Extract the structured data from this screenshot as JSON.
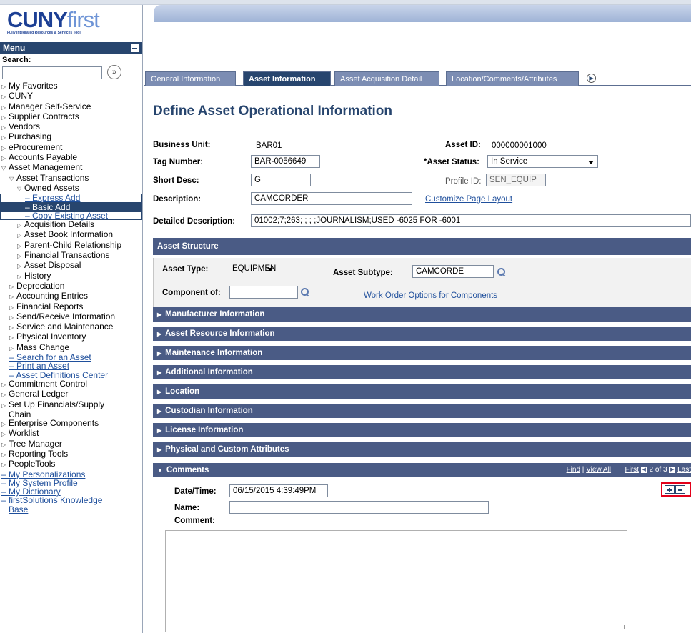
{
  "logo": {
    "cuny": "CUNY",
    "first": "first",
    "tagline": "Fully Integrated Resources & Services Tool"
  },
  "menu": {
    "title": "Menu",
    "search_label": "Search:",
    "search_value": "",
    "search_go": "»"
  },
  "nav": [
    {
      "label": "My Favorites",
      "indent": 0,
      "kind": "folder"
    },
    {
      "label": "CUNY",
      "indent": 0,
      "kind": "folder"
    },
    {
      "label": "Manager Self-Service",
      "indent": 0,
      "kind": "folder"
    },
    {
      "label": "Supplier Contracts",
      "indent": 0,
      "kind": "folder"
    },
    {
      "label": "Vendors",
      "indent": 0,
      "kind": "folder"
    },
    {
      "label": "Purchasing",
      "indent": 0,
      "kind": "folder"
    },
    {
      "label": "eProcurement",
      "indent": 0,
      "kind": "folder"
    },
    {
      "label": "Accounts Payable",
      "indent": 0,
      "kind": "folder"
    },
    {
      "label": "Asset Management",
      "indent": 0,
      "kind": "open"
    },
    {
      "label": "Asset Transactions",
      "indent": 1,
      "kind": "open"
    },
    {
      "label": "Owned Assets",
      "indent": 2,
      "kind": "open"
    },
    {
      "label": "Express Add",
      "indent": 3,
      "kind": "link"
    },
    {
      "label": "Basic Add",
      "indent": 3,
      "kind": "selected"
    },
    {
      "label": "Copy Existing Asset",
      "indent": 3,
      "kind": "link"
    },
    {
      "label": "Acquisition Details",
      "indent": 2,
      "kind": "folder"
    },
    {
      "label": "Asset Book Information",
      "indent": 2,
      "kind": "folder"
    },
    {
      "label": "Parent-Child Relationship",
      "indent": 2,
      "kind": "folder"
    },
    {
      "label": "Financial Transactions",
      "indent": 2,
      "kind": "folder"
    },
    {
      "label": "Asset Disposal",
      "indent": 2,
      "kind": "folder"
    },
    {
      "label": "History",
      "indent": 2,
      "kind": "folder"
    },
    {
      "label": "Depreciation",
      "indent": 1,
      "kind": "folder"
    },
    {
      "label": "Accounting Entries",
      "indent": 1,
      "kind": "folder"
    },
    {
      "label": "Financial Reports",
      "indent": 1,
      "kind": "folder"
    },
    {
      "label": "Send/Receive Information",
      "indent": 1,
      "kind": "folder"
    },
    {
      "label": "Service and Maintenance",
      "indent": 1,
      "kind": "folder"
    },
    {
      "label": "Physical Inventory",
      "indent": 1,
      "kind": "folder"
    },
    {
      "label": "Mass Change",
      "indent": 1,
      "kind": "folder"
    },
    {
      "label": "Search for an Asset",
      "indent": 1,
      "kind": "link"
    },
    {
      "label": "Print an Asset",
      "indent": 1,
      "kind": "link"
    },
    {
      "label": "Asset Definitions Center",
      "indent": 1,
      "kind": "link"
    },
    {
      "label": "Commitment Control",
      "indent": 0,
      "kind": "folder"
    },
    {
      "label": "General Ledger",
      "indent": 0,
      "kind": "folder"
    },
    {
      "label": "Set Up Financials/Supply",
      "indent": 0,
      "kind": "folder"
    },
    {
      "label": "Chain",
      "indent": 0,
      "kind": "cont"
    },
    {
      "label": "Enterprise Components",
      "indent": 0,
      "kind": "folder"
    },
    {
      "label": "Worklist",
      "indent": 0,
      "kind": "folder"
    },
    {
      "label": "Tree Manager",
      "indent": 0,
      "kind": "folder"
    },
    {
      "label": "Reporting Tools",
      "indent": 0,
      "kind": "folder"
    },
    {
      "label": "PeopleTools",
      "indent": 0,
      "kind": "folder"
    },
    {
      "label": "My Personalizations",
      "indent": 0,
      "kind": "link"
    },
    {
      "label": "My System Profile",
      "indent": 0,
      "kind": "link"
    },
    {
      "label": "My Dictionary",
      "indent": 0,
      "kind": "link"
    },
    {
      "label": "firstSolutions Knowledge",
      "indent": 0,
      "kind": "link"
    },
    {
      "label": "Base",
      "indent": 0,
      "kind": "cont-link"
    }
  ],
  "tabs": [
    "General Information",
    "Asset Information",
    "Asset Acquisition Detail",
    "Location/Comments/Attributes"
  ],
  "active_tab": "Asset Information",
  "page_title": "Define Asset Operational Information",
  "fields": {
    "business_unit_label": "Business Unit:",
    "business_unit": "BAR01",
    "asset_id_label": "Asset ID:",
    "asset_id": "000000001000",
    "tag_number_label": "Tag Number:",
    "tag_number": "BAR-0056649",
    "asset_status_label": "*Asset Status:",
    "asset_status": "In Service",
    "short_desc_label": "Short Desc:",
    "short_desc": "G",
    "profile_id_label": "Profile ID:",
    "profile_id": "SEN_EQUIP",
    "description_label": "Description:",
    "description": "CAMCORDER",
    "customize_link": "Customize Page Layout",
    "detailed_desc_label": "Detailed Description:",
    "detailed_desc": "01002;7;263; ; ; ;JOURNALISM;USED -6025 FOR -6001"
  },
  "asset_structure": {
    "header": "Asset Structure",
    "asset_type_label": "Asset Type:",
    "asset_type": "EQUIPMEN'",
    "asset_subtype_label": "Asset Subtype:",
    "asset_subtype": "CAMCORDE",
    "component_of_label": "Component of:",
    "component_of": "",
    "work_order_link": "Work Order Options for Components"
  },
  "sections": [
    "Manufacturer Information",
    "Asset Resource Information",
    "Maintenance Information",
    "Additional Information",
    "Location",
    "Custodian Information",
    "License Information",
    "Physical and Custom Attributes"
  ],
  "comments": {
    "header": "Comments",
    "find": "Find",
    "view_all": "View All",
    "first": "First",
    "position": "2 of 3",
    "last": "Last",
    "datetime_label": "Date/Time:",
    "datetime": "06/15/2015  4:39:49PM",
    "name_label": "Name:",
    "name": "",
    "comment_label": "Comment:",
    "comment": ""
  }
}
